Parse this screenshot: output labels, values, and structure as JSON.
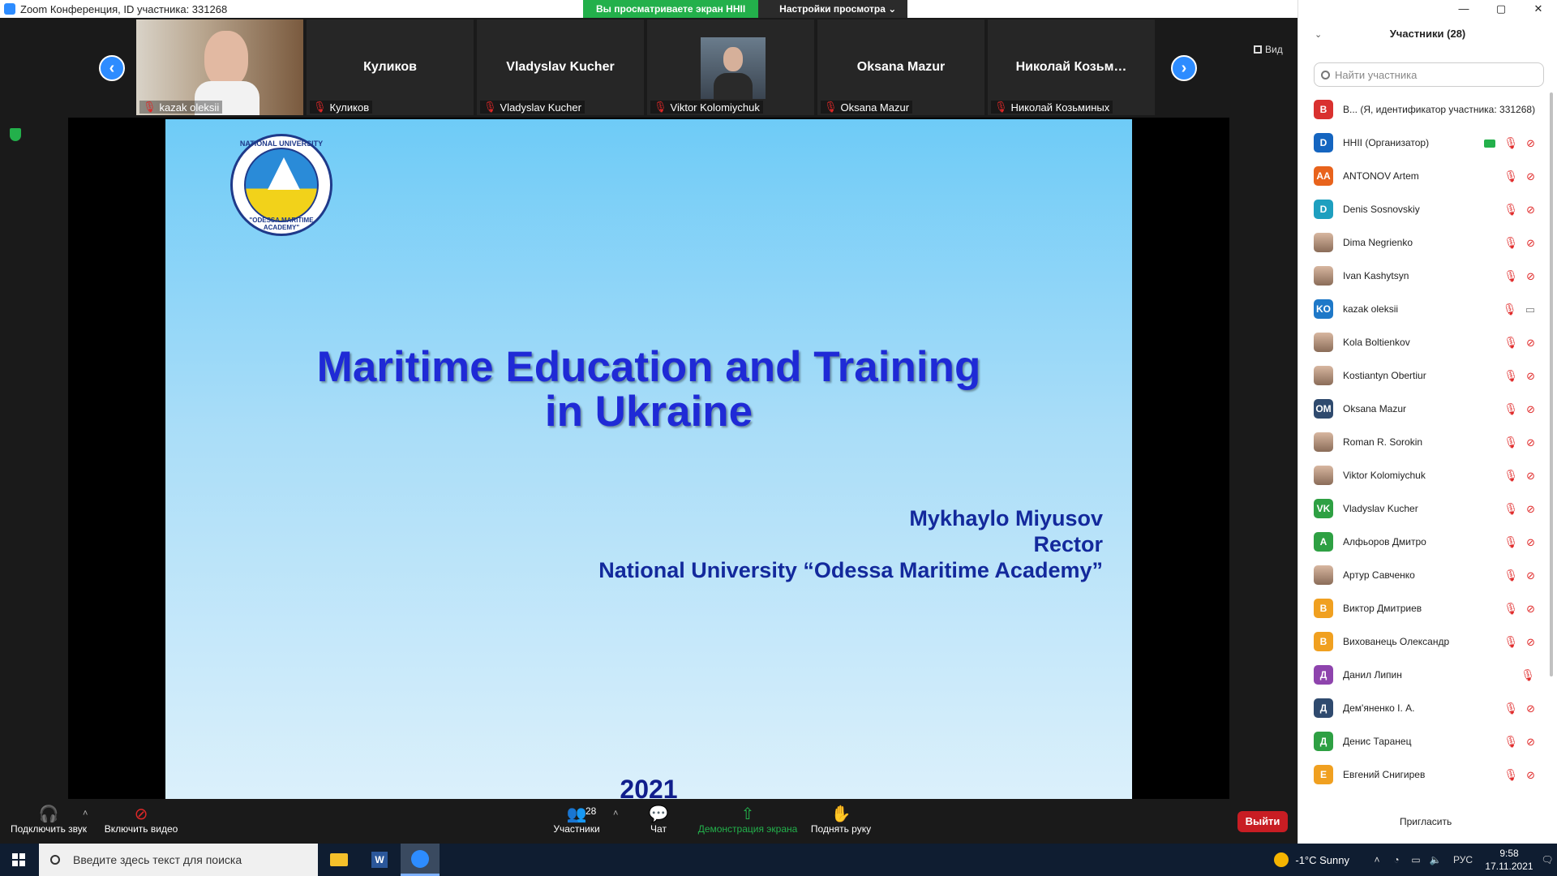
{
  "window": {
    "title": "Zoom Конференция, ID участника: 331268",
    "controls": [
      "—",
      "▢",
      "✕"
    ]
  },
  "share_banner": {
    "viewing": "Вы просматриваете экран HHII",
    "view_options": "Настройки просмотра ⌄"
  },
  "gallery": {
    "view_label": "Вид",
    "tiles": [
      {
        "big": "",
        "caption": "kazak oleksii",
        "video": true
      },
      {
        "big": "Куликов",
        "caption": "Куликов",
        "video": false
      },
      {
        "big": "Vladyslav Kucher",
        "caption": "Vladyslav Kucher",
        "video": false
      },
      {
        "big": "",
        "caption": "Viktor Kolomiychuk",
        "video": true
      },
      {
        "big": "Oksana Mazur",
        "caption": "Oksana Mazur",
        "video": false
      },
      {
        "big": "Николай  Козьм…",
        "caption": "Николай Козьминых",
        "video": false
      }
    ]
  },
  "slide": {
    "logo_top": "NATIONAL UNIVERSITY",
    "logo_bottom": "\"ODESSA MARITIME ACADEMY\"",
    "title_line1": "Maritime Education and Training",
    "title_line2": "in Ukraine",
    "author": "Mykhaylo Miyusov",
    "position": "Rector",
    "university": "National University “Odessa Maritime Academy”",
    "year": "2021"
  },
  "toolbar": {
    "audio": "Подключить звук",
    "video": "Включить видео",
    "participants": "Участники",
    "participants_count": "28",
    "chat": "Чат",
    "share": "Демонстрация экрана",
    "raise_hand": "Поднять руку",
    "leave": "Выйти"
  },
  "panel": {
    "header": "Участники (28)",
    "search_placeholder": "Найти участника",
    "invite": "Пригласить",
    "participants": [
      {
        "initials": "B",
        "color": "#d9312f",
        "name": "B... (Я, идентификатор участника: 331268)",
        "photo": false,
        "icons": "none"
      },
      {
        "initials": "D",
        "color": "#1565c0",
        "name": "HHII (Организатор)",
        "photo": false,
        "icons": "share"
      },
      {
        "initials": "AA",
        "color": "#e8631c",
        "name": "ANTONOV Artem",
        "photo": false,
        "icons": "muted"
      },
      {
        "initials": "D",
        "color": "#1e9fbf",
        "name": "Denis Sosnovskiy",
        "photo": false,
        "icons": "muted"
      },
      {
        "initials": "",
        "color": "#9a7a64",
        "name": "Dima Negrienko",
        "photo": true,
        "icons": "muted"
      },
      {
        "initials": "",
        "color": "#9a7a64",
        "name": "Ivan Kashytsyn",
        "photo": true,
        "icons": "muted"
      },
      {
        "initials": "KO",
        "color": "#1e78c8",
        "name": "kazak oleksii",
        "photo": false,
        "icons": "camon"
      },
      {
        "initials": "",
        "color": "#9a7a64",
        "name": "Kola Boltienkov",
        "photo": true,
        "icons": "muted"
      },
      {
        "initials": "",
        "color": "#9a7a64",
        "name": "Kostiantyn Obertiur",
        "photo": true,
        "icons": "muted"
      },
      {
        "initials": "OM",
        "color": "#2f4a6e",
        "name": "Oksana Mazur",
        "photo": false,
        "icons": "muted"
      },
      {
        "initials": "",
        "color": "#9a7a64",
        "name": "Roman R. Sorokin",
        "photo": true,
        "icons": "muted"
      },
      {
        "initials": "",
        "color": "#6a7a8a",
        "name": "Viktor Kolomiychuk",
        "photo": true,
        "icons": "muted"
      },
      {
        "initials": "VK",
        "color": "#2ea043",
        "name": "Vladyslav Kucher",
        "photo": false,
        "icons": "muted"
      },
      {
        "initials": "A",
        "color": "#2ea043",
        "name": "Алфьоров Дмитро",
        "photo": false,
        "icons": "muted"
      },
      {
        "initials": "",
        "color": "#9a7a64",
        "name": "Артур Савченко",
        "photo": true,
        "icons": "muted"
      },
      {
        "initials": "B",
        "color": "#f0a020",
        "name": "Виктор Дмитриев",
        "photo": false,
        "icons": "muted"
      },
      {
        "initials": "B",
        "color": "#f0a020",
        "name": "Вихованець Олександр",
        "photo": false,
        "icons": "muted"
      },
      {
        "initials": "Д",
        "color": "#8e44ad",
        "name": "Данил Липин",
        "photo": false,
        "icons": "camoff"
      },
      {
        "initials": "Д",
        "color": "#2f4a6e",
        "name": "Дем'яненко І. А.",
        "photo": false,
        "icons": "muted"
      },
      {
        "initials": "Д",
        "color": "#2ea043",
        "name": "Денис Таранец",
        "photo": false,
        "icons": "muted"
      },
      {
        "initials": "E",
        "color": "#f0a020",
        "name": "Евгений Снигирев",
        "photo": false,
        "icons": "muted"
      }
    ]
  },
  "taskbar": {
    "search_placeholder": "Введите здесь текст для поиска",
    "weather": "-1°C  Sunny",
    "lang": "РУС",
    "time": "9:58",
    "date": "17.11.2021"
  }
}
